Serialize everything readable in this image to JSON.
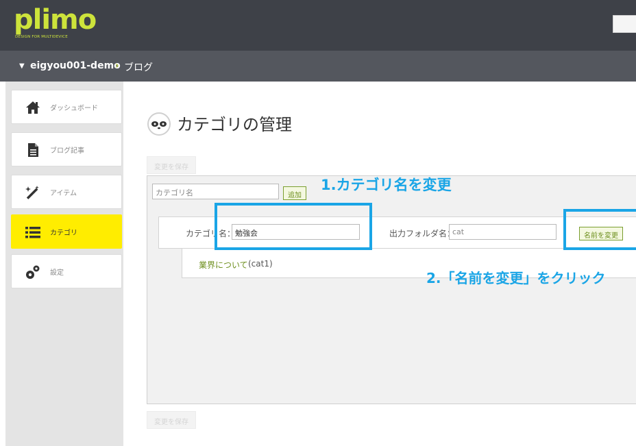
{
  "header": {
    "logo": "plimo",
    "logo_sub": "DESIGN FOR MULTIDEVICE"
  },
  "breadcrumb": {
    "arrow": "▼",
    "site": "eigyou001-demo",
    "separator": "›",
    "page": "ブログ"
  },
  "sidebar": {
    "items": [
      {
        "label": "ダッシュボード",
        "icon": "home-icon"
      },
      {
        "label": "ブログ記事",
        "icon": "document-icon"
      },
      {
        "label": "アイテム",
        "icon": "magic-wand-icon"
      },
      {
        "label": "カテゴリ",
        "icon": "list-icon",
        "active": true
      },
      {
        "label": "設定",
        "icon": "gears-icon"
      }
    ]
  },
  "main": {
    "title": "カテゴリの管理",
    "save_top": "変更を保存",
    "save_bottom": "変更を保存",
    "new_category_placeholder": "カテゴリ名",
    "add_button": "追加",
    "category": {
      "name_label": "カテゴリ名：",
      "name_value": "勉強会",
      "folder_label": "出力フォルダ名：",
      "folder_value": "cat",
      "rename_button": "名前を変更"
    },
    "sub_category": {
      "name": "業界について",
      "code": "(cat1)"
    }
  },
  "annotations": {
    "step1": "1.カテゴリ名を変更",
    "step2": "2.「名前を変更」をクリック"
  },
  "colors": {
    "header_bg": "#3e4148",
    "breadcrumb_bg": "#54575e",
    "brand": "#cde33b",
    "active_nav": "#ffed00",
    "annotation": "#1aa5e6",
    "button_green": "#6d8f1d"
  }
}
